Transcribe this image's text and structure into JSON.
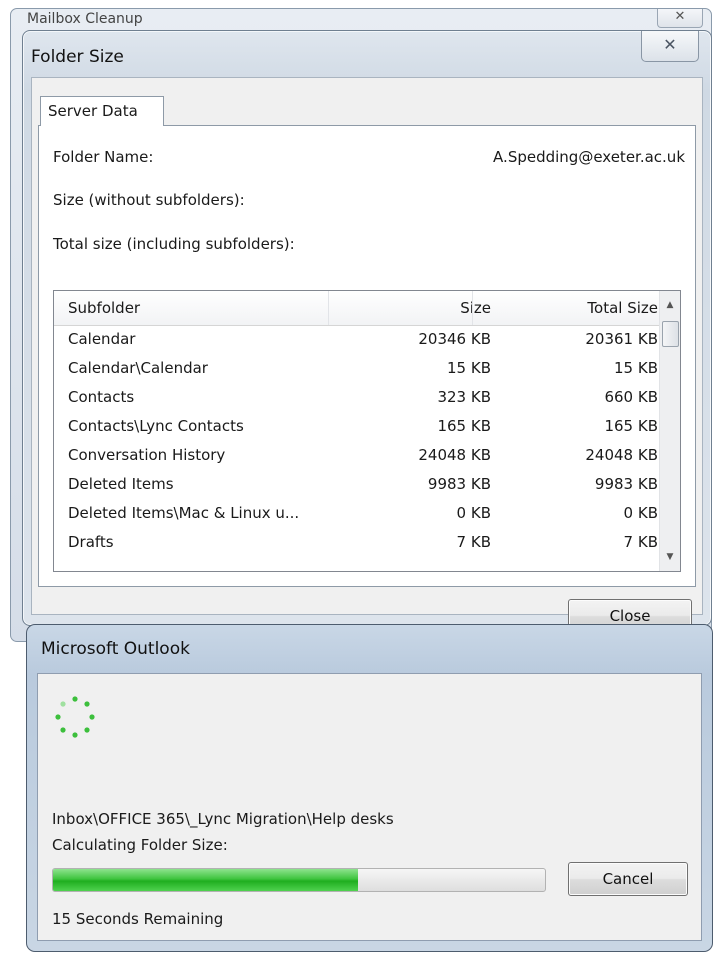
{
  "background_window": {
    "title": "Mailbox Cleanup",
    "close_glyph": "✕"
  },
  "folder_size_dialog": {
    "title": "Folder Size",
    "close_glyph": "✕",
    "tab_label": "Server Data",
    "folder_name_label": "Folder Name:",
    "folder_name_value": "A.Spedding@exeter.ac.uk",
    "size_label": "Size (without subfolders):",
    "total_size_label": "Total size (including subfolders):",
    "columns": {
      "subfolder": "Subfolder",
      "size": "Size",
      "total_size": "Total Size"
    },
    "rows": [
      {
        "name": "Calendar",
        "size": "20346 KB",
        "total": "20361 KB"
      },
      {
        "name": "Calendar\\Calendar",
        "size": "15 KB",
        "total": "15 KB"
      },
      {
        "name": "Contacts",
        "size": "323 KB",
        "total": "660 KB"
      },
      {
        "name": "Contacts\\Lync Contacts",
        "size": "165 KB",
        "total": "165 KB"
      },
      {
        "name": "Conversation History",
        "size": "24048 KB",
        "total": "24048 KB"
      },
      {
        "name": "Deleted Items",
        "size": "9983 KB",
        "total": "9983 KB"
      },
      {
        "name": "Deleted Items\\Mac & Linux u...",
        "size": "0 KB",
        "total": "0 KB"
      },
      {
        "name": "Drafts",
        "size": "7 KB",
        "total": "7 KB"
      }
    ],
    "scroll_up_icon": "▲",
    "scroll_down_icon": "▼",
    "close_button": "Close"
  },
  "outlook_dialog": {
    "title": "Microsoft Outlook",
    "path": "Inbox\\OFFICE 365\\_Lync Migration\\Help desks",
    "status": "Calculating Folder Size:",
    "progress": 0.62,
    "cancel_button": "Cancel",
    "remaining": "15 Seconds Remaining"
  },
  "colors": {
    "progress_green": "#2db52d",
    "spinner_green": "#3cbf3c",
    "dialog_frame": "#cfd9e4"
  }
}
